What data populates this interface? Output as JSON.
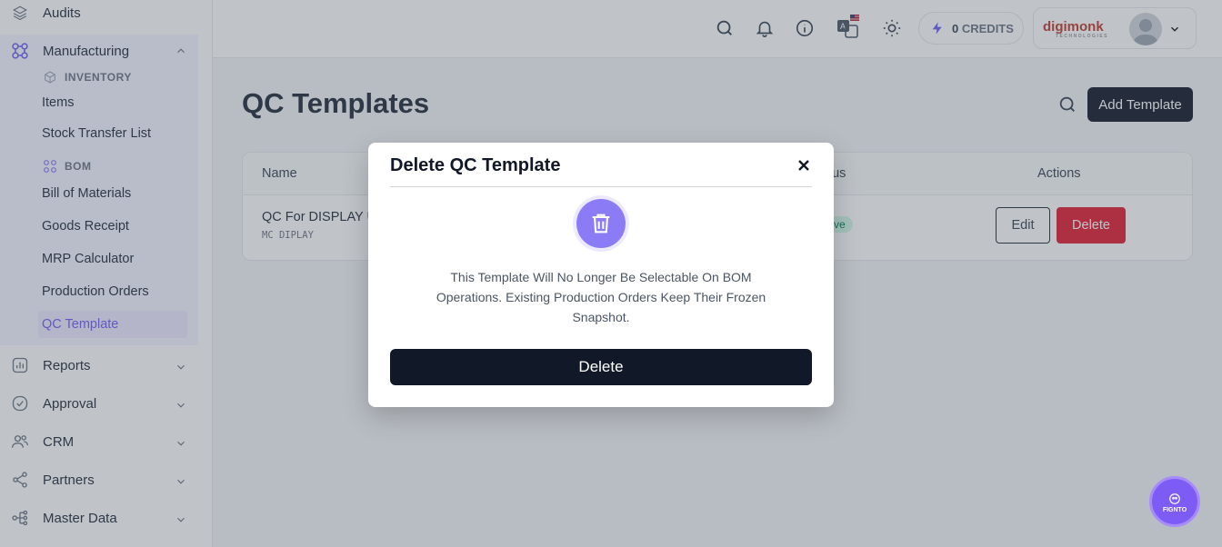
{
  "sidebar": {
    "top_item": "Audits",
    "manufacturing": "Manufacturing",
    "inventory_head": "INVENTORY",
    "inventory_items": [
      "Items",
      "Stock Transfer List"
    ],
    "bom_head": "BOM",
    "bom_items": [
      "Bill of Materials",
      "Goods Receipt",
      "MRP Calculator",
      "Production Orders",
      "QC Template"
    ],
    "sections": [
      "Reports",
      "Approval",
      "CRM",
      "Partners",
      "Master Data"
    ]
  },
  "topbar": {
    "credits_count": "0",
    "credits_label": "CREDITS",
    "brand": "digimonk",
    "brand_sub": "TECHNOLOGIES"
  },
  "main": {
    "title": "QC Templates",
    "add_button": "Add Template",
    "table": {
      "headers": [
        "Name",
        "Status",
        "Actions"
      ],
      "header_status_visible": "atus",
      "row": {
        "name": "QC For DISPLAY U",
        "code": "MC DIPLAY",
        "status": "ctive",
        "edit": "Edit",
        "delete": "Delete"
      }
    }
  },
  "modal": {
    "title": "Delete QC Template",
    "message": "This Template Will No Longer Be Selectable On BOM Operations. Existing Production Orders Keep Their Frozen Snapshot.",
    "confirm": "Delete"
  },
  "fab": {
    "label": "FIGNTO"
  },
  "colors": {
    "accent": "#6d5df0",
    "danger": "#e11d2e",
    "dark": "#111827"
  }
}
